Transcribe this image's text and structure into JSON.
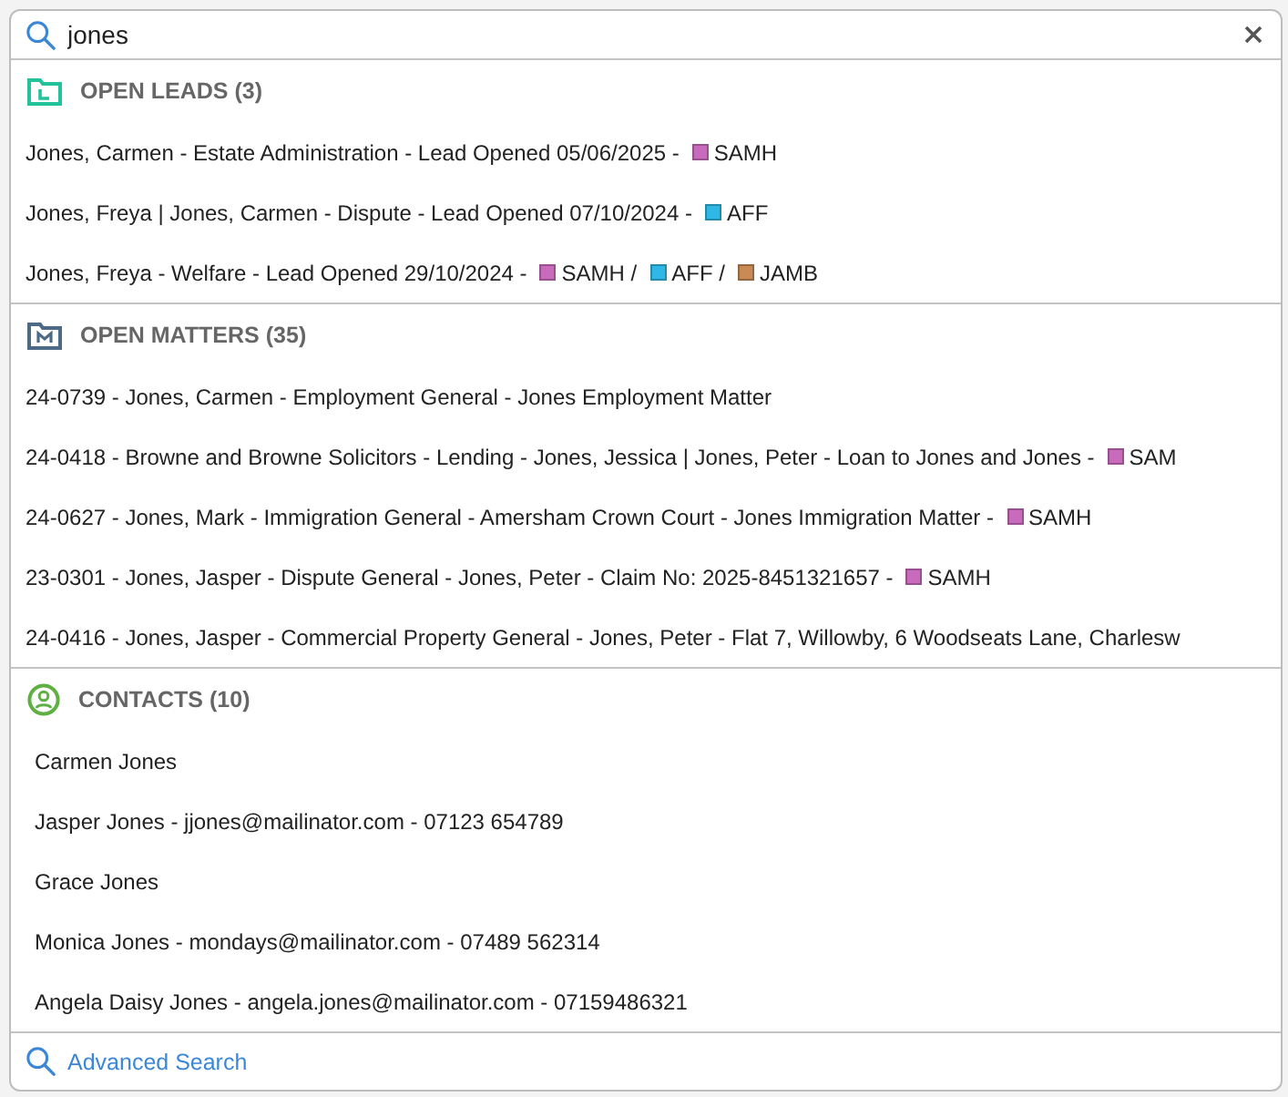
{
  "search": {
    "value": "jones"
  },
  "sections": [
    {
      "kind": "leads",
      "title": "OPEN LEADS",
      "count": "(3)",
      "items": [
        {
          "text": "Jones, Carmen - Estate Administration - Lead Opened 05/06/2025 -",
          "tags": [
            {
              "label": "SAMH",
              "color": "#c86bbd"
            }
          ]
        },
        {
          "text": "Jones, Freya | Jones, Carmen - Dispute - Lead Opened 07/10/2024 -",
          "tags": [
            {
              "label": "AFF",
              "color": "#2fb8e6"
            }
          ]
        },
        {
          "text": "Jones, Freya - Welfare - Lead Opened 29/10/2024 -",
          "tags": [
            {
              "label": "SAMH /",
              "color": "#c86bbd"
            },
            {
              "label": "AFF /",
              "color": "#2fb8e6"
            },
            {
              "label": "JAMB",
              "color": "#c98a55"
            }
          ]
        }
      ]
    },
    {
      "kind": "matters",
      "title": "OPEN MATTERS",
      "count": "(35)",
      "items": [
        {
          "text": "24-0739 - Jones, Carmen - Employment General - Jones Employment Matter"
        },
        {
          "text": "24-0418 - Browne and Browne Solicitors - Lending - Jones, Jessica | Jones, Peter - Loan to Jones and Jones -",
          "tags": [
            {
              "label": "SAM",
              "color": "#c86bbd"
            }
          ]
        },
        {
          "text": "24-0627 - Jones, Mark - Immigration General - Amersham Crown Court - Jones Immigration Matter -",
          "tags": [
            {
              "label": "SAMH",
              "color": "#c86bbd"
            }
          ]
        },
        {
          "text": "23-0301 - Jones, Jasper - Dispute General - Jones, Peter - Claim No: 2025-8451321657 -",
          "tags": [
            {
              "label": "SAMH",
              "color": "#c86bbd"
            }
          ]
        },
        {
          "text": "24-0416 - Jones, Jasper - Commercial Property General - Jones, Peter - Flat 7, Willowby, 6 Woodseats Lane, Charlesw"
        }
      ]
    },
    {
      "kind": "contacts",
      "title": "CONTACTS",
      "count": "(10)",
      "items": [
        {
          "text": "Carmen Jones"
        },
        {
          "text": "Jasper Jones - jjones@mailinator.com - 07123 654789"
        },
        {
          "text": "Grace Jones"
        },
        {
          "text": "Monica Jones - mondays@mailinator.com - 07489 562314"
        },
        {
          "text": "Angela Daisy Jones - angela.jones@mailinator.com - 07159486321"
        }
      ]
    }
  ],
  "footer": {
    "link": "Advanced Search"
  }
}
